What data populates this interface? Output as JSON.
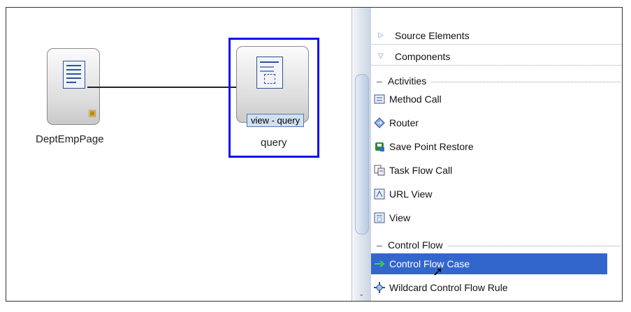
{
  "diagram": {
    "nodes": [
      {
        "label": "DeptEmpPage",
        "badge": "page-flag-icon"
      },
      {
        "label": "query",
        "selected": true
      }
    ],
    "tooltip": "view - query"
  },
  "palette": {
    "headers": [
      {
        "label": "Source Elements",
        "expanded": false
      },
      {
        "label": "Components",
        "expanded": true
      }
    ],
    "sections": [
      {
        "label": "Activities",
        "items": [
          {
            "label": "Method Call",
            "icon": "method-call-icon"
          },
          {
            "label": "Router",
            "icon": "router-icon"
          },
          {
            "label": "Save Point Restore",
            "icon": "save-point-restore-icon"
          },
          {
            "label": "Task Flow Call",
            "icon": "task-flow-call-icon"
          },
          {
            "label": "URL View",
            "icon": "url-view-icon"
          },
          {
            "label": "View",
            "icon": "view-icon"
          }
        ]
      },
      {
        "label": "Control Flow",
        "items": [
          {
            "label": "Control Flow Case",
            "icon": "control-flow-case-icon",
            "selected": true
          },
          {
            "label": "Wildcard Control Flow Rule",
            "icon": "wildcard-rule-icon"
          }
        ]
      }
    ]
  },
  "colors": {
    "selection": "#1010ee",
    "highlight": "#3366cc"
  }
}
